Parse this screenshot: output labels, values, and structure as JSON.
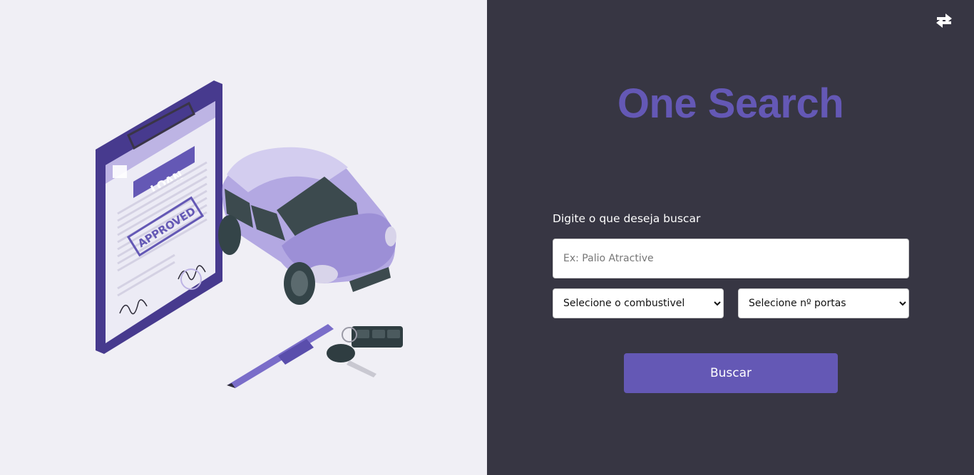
{
  "app": {
    "title": "One Search"
  },
  "illustration": {
    "clipboard_header": "LOAN",
    "stamp": "APPROVED"
  },
  "form": {
    "label": "Digite o que deseja buscar",
    "search_placeholder": "Ex: Palio Atractive",
    "fuel_select": {
      "selected": "Selecione o combustivel"
    },
    "doors_select": {
      "selected": "Selecione nº portas"
    },
    "submit_label": "Buscar"
  },
  "colors": {
    "accent": "#6458b5",
    "panel_dark": "#373643",
    "panel_light": "#f0eff5"
  },
  "icons": {
    "toggle": "swap-arrows-icon"
  }
}
